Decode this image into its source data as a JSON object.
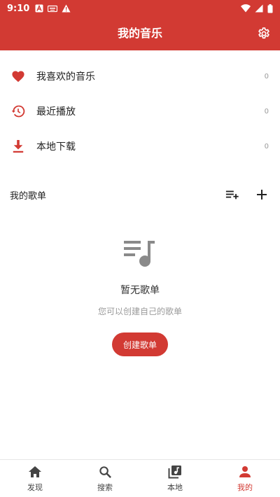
{
  "status_bar": {
    "time": "9:10",
    "icons_left": [
      "a-app-icon",
      "keyboard-icon",
      "warning-icon"
    ],
    "icons_right": [
      "wifi-icon",
      "signal-icon",
      "battery-icon"
    ]
  },
  "header": {
    "title": "我的音乐",
    "settings_icon": "gear-icon"
  },
  "library": [
    {
      "label": "我喜欢的音乐",
      "count": "0",
      "icon": "heart-icon"
    },
    {
      "label": "最近播放",
      "count": "0",
      "icon": "history-icon"
    },
    {
      "label": "本地下载",
      "count": "0",
      "icon": "download-icon"
    }
  ],
  "playlists": {
    "title": "我的歌单",
    "actions": [
      "playlist-add-icon",
      "plus-icon"
    ]
  },
  "empty_state": {
    "icon": "playlist-music-icon",
    "title": "暂无歌单",
    "subtitle": "您可以创建自己的歌单",
    "button_label": "创建歌单"
  },
  "bottom_nav": [
    {
      "label": "发现",
      "icon": "home-icon",
      "active": false
    },
    {
      "label": "搜索",
      "icon": "search-icon",
      "active": false
    },
    {
      "label": "本地",
      "icon": "library-music-icon",
      "active": false
    },
    {
      "label": "我的",
      "icon": "person-icon",
      "active": true
    }
  ],
  "colors": {
    "accent": "#d23a33",
    "text": "#222222",
    "muted": "#9a9a9a",
    "icon_gray": "#8a8a8a"
  }
}
